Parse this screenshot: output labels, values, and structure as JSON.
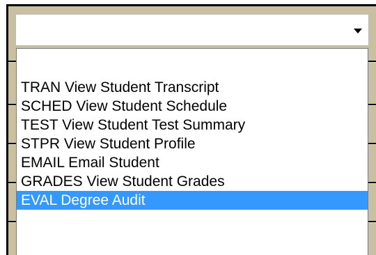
{
  "dropdown": {
    "value": "",
    "options": [
      "TRAN View Student Transcript",
      "SCHED View Student Schedule",
      "TEST View Student Test Summary",
      "STPR View Student Profile",
      "EMAIL Email Student",
      "GRADES View Student Grades",
      "EVAL Degree Audit"
    ],
    "selected_index": 6
  },
  "colors": {
    "panel_background": "#c8c0a0",
    "highlight": "#3399ff",
    "highlight_text": "#ffffff"
  },
  "icons": {
    "dropdown_arrow": "chevron-down-icon"
  }
}
